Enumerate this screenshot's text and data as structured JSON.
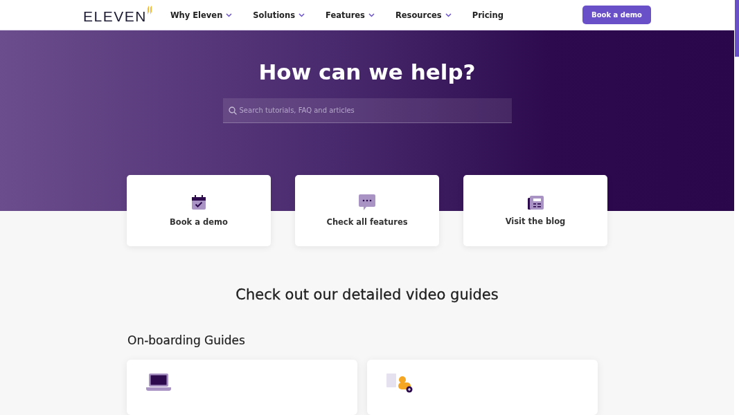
{
  "header": {
    "logo": "ELEVEN",
    "nav": [
      {
        "label": "Why Eleven",
        "dropdown": true
      },
      {
        "label": "Solutions",
        "dropdown": true
      },
      {
        "label": "Features",
        "dropdown": true
      },
      {
        "label": "Resources",
        "dropdown": true
      },
      {
        "label": "Pricing",
        "dropdown": false
      }
    ],
    "cta": "Book a demo"
  },
  "hero": {
    "title": "How can we help?",
    "search": {
      "placeholder": "Search tutorials, FAQ and articles"
    }
  },
  "quick_links": [
    {
      "kind": "calendar",
      "label": "Book a demo"
    },
    {
      "kind": "chat",
      "label": "Check all features"
    },
    {
      "kind": "newspaper",
      "label": "Visit the blog"
    }
  ],
  "section_title": "Check out our detailed video guides",
  "guides": {
    "title": "On-boarding Guides",
    "cards": [
      {
        "kind": "laptop"
      },
      {
        "kind": "user-building"
      }
    ]
  }
}
